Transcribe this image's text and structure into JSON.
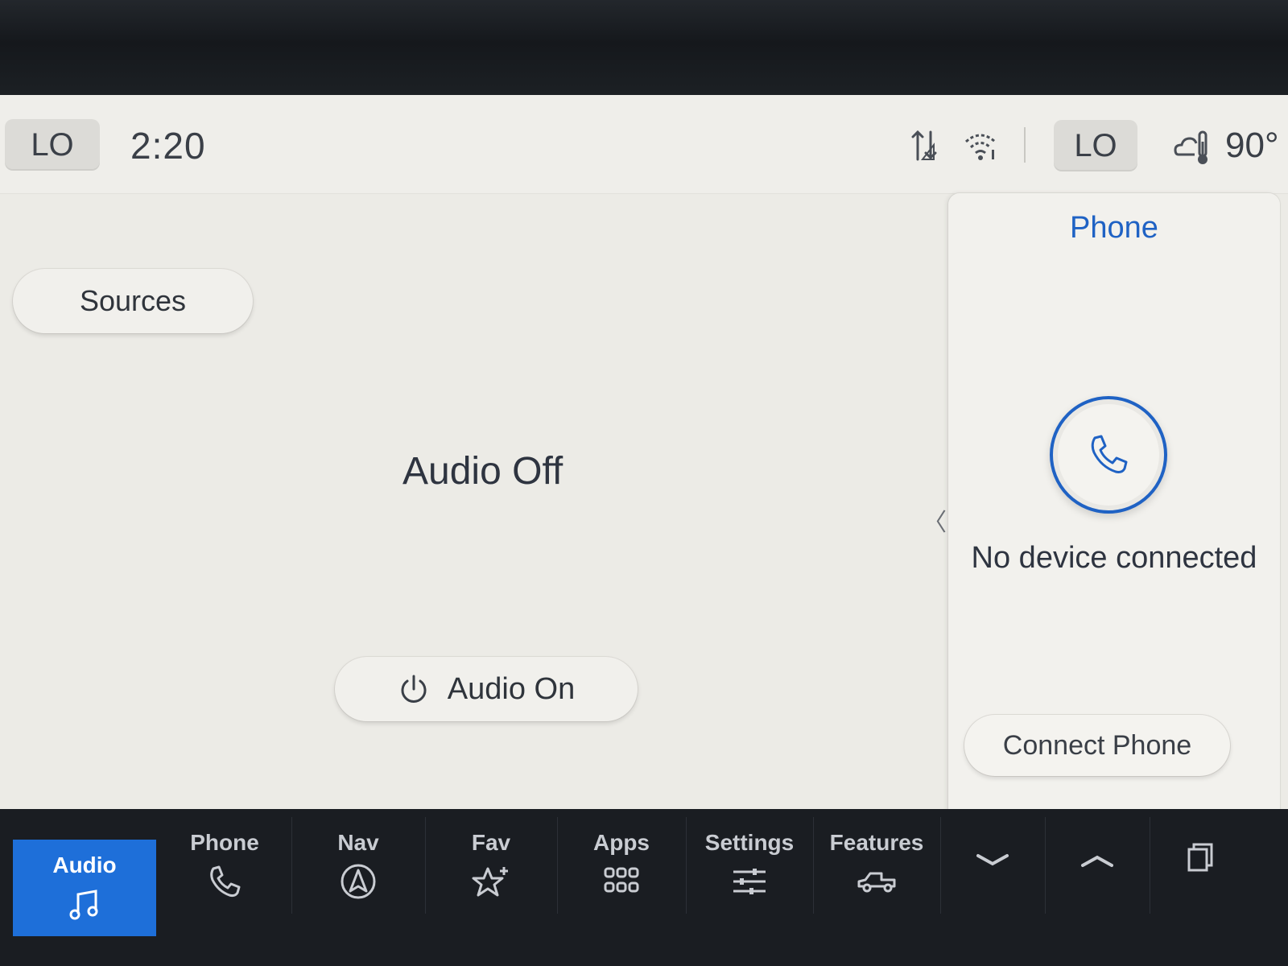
{
  "status_bar": {
    "left_climate": "LO",
    "time": "2:20",
    "right_climate": "LO",
    "temperature": "90°",
    "icons": [
      "data-transfer-icon",
      "wifi-icon",
      "weather-thermometer-icon"
    ]
  },
  "audio": {
    "sources_label": "Sources",
    "status_text": "Audio Off",
    "audio_on_label": "Audio On",
    "power_icon": "power-icon"
  },
  "phone_panel": {
    "title": "Phone",
    "status": "No device connected",
    "connect_label": "Connect Phone",
    "collapse_glyph": "〈"
  },
  "nav": {
    "audio": "Audio",
    "phone": "Phone",
    "nav": "Nav",
    "fav": "Fav",
    "apps": "Apps",
    "settings": "Settings",
    "features": "Features",
    "active": "Audio"
  },
  "colors": {
    "accent": "#1e6fd9",
    "phone_title": "#1f62c4",
    "screen_bg": "#ecebe6",
    "nav_bg": "#1a1d22"
  }
}
